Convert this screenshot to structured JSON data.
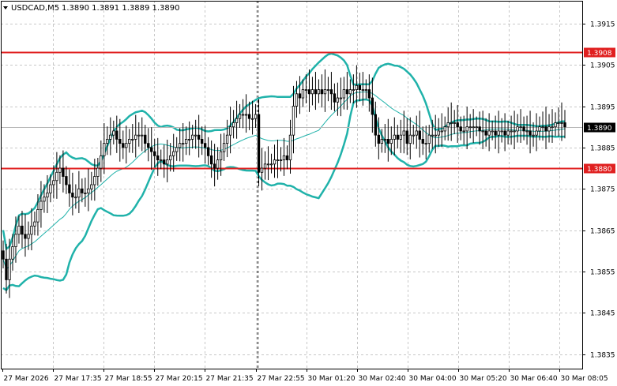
{
  "header": {
    "symbol": "USDCAD,M5",
    "ohlc": "1.3890 1.3891 1.3889 1.3890",
    "menu_icon": "triangle-down-icon"
  },
  "chart_data": {
    "type": "candlestick",
    "title": "USDCAD,M5",
    "ylim": [
      1.38315,
      1.39205
    ],
    "y_ticks": [
      "1.3915",
      "1.3905",
      "1.3895",
      "1.3885",
      "1.3875",
      "1.3865",
      "1.3855",
      "1.3845",
      "1.3835"
    ],
    "x_ticks": [
      "27 Mar 2026",
      "27 Mar 17:35",
      "27 Mar 18:55",
      "27 Mar 20:15",
      "27 Mar 21:35",
      "27 Mar 22:55",
      "30 Mar 01:20",
      "30 Mar 02:40",
      "30 Mar 04:00",
      "30 Mar 05:20",
      "30 Mar 06:40",
      "30 Mar 08:05"
    ],
    "grid": true,
    "horizontal_levels": [
      {
        "value": 1.3908,
        "label": "1.3908",
        "color": "#e02020"
      },
      {
        "value": 1.388,
        "label": "1.3880",
        "color": "#e02020"
      }
    ],
    "current_price": {
      "value": 1.389,
      "label": "1.3890"
    },
    "session_separator_bar": 81,
    "colors": {
      "bollinger": "#20b2aa",
      "candle": "#000000",
      "background": "#ffffff",
      "grid": "#c8c8c8"
    },
    "closes": [
      1.3858,
      1.3853,
      1.3858,
      1.3861,
      1.3864,
      1.3866,
      1.3864,
      1.3863,
      1.3864,
      1.3866,
      1.3867,
      1.387,
      1.3872,
      1.3873,
      1.3874,
      1.3876,
      1.3877,
      1.3879,
      1.388,
      1.3878,
      1.3876,
      1.3874,
      1.3873,
      1.3873,
      1.3875,
      1.3874,
      1.3874,
      1.3875,
      1.3876,
      1.3878,
      1.388,
      1.3883,
      1.3886,
      1.3887,
      1.3888,
      1.3889,
      1.3887,
      1.3886,
      1.3885,
      1.3886,
      1.3887,
      1.3887,
      1.3888,
      1.3888,
      1.3888,
      1.3886,
      1.3885,
      1.3884,
      1.3883,
      1.3882,
      1.3882,
      1.3881,
      1.3882,
      1.3883,
      1.3884,
      1.3885,
      1.3886,
      1.3886,
      1.3887,
      1.3887,
      1.3888,
      1.3888,
      1.3887,
      1.3886,
      1.3885,
      1.3883,
      1.3881,
      1.388,
      1.3882,
      1.3884,
      1.3886,
      1.3888,
      1.389,
      1.3891,
      1.3892,
      1.3893,
      1.3893,
      1.3893,
      1.3892,
      1.3892,
      1.3893,
      1.3879,
      1.388,
      1.3881,
      1.3881,
      1.3881,
      1.3882,
      1.3882,
      1.3882,
      1.3883,
      1.3882,
      1.3888,
      1.3895,
      1.3898,
      1.3897,
      1.3899,
      1.3899,
      1.3898,
      1.3899,
      1.3898,
      1.3899,
      1.3898,
      1.3899,
      1.3899,
      1.3898,
      1.3896,
      1.3897,
      1.3897,
      1.3899,
      1.3898,
      1.3899,
      1.3899,
      1.39,
      1.3899,
      1.3899,
      1.3899,
      1.3897,
      1.3893,
      1.3888,
      1.3886,
      1.3887,
      1.3887,
      1.3886,
      1.3887,
      1.3888,
      1.3887,
      1.3888,
      1.3889,
      1.3886,
      1.3888,
      1.3888,
      1.3889,
      1.3887,
      1.3886,
      1.3886,
      1.3888,
      1.3888,
      1.3888,
      1.3889,
      1.3889,
      1.389,
      1.3891,
      1.3891,
      1.3891,
      1.389,
      1.3889,
      1.3889,
      1.389,
      1.389,
      1.389,
      1.389,
      1.3889,
      1.3889,
      1.3888,
      1.3889,
      1.3889,
      1.3888,
      1.3889,
      1.3889,
      1.3888,
      1.3889,
      1.3889,
      1.3889,
      1.389,
      1.389,
      1.3889,
      1.3889,
      1.3888,
      1.3888,
      1.3889,
      1.389,
      1.389,
      1.3889,
      1.389,
      1.389,
      1.3891,
      1.3891,
      1.3891,
      1.389
    ]
  }
}
